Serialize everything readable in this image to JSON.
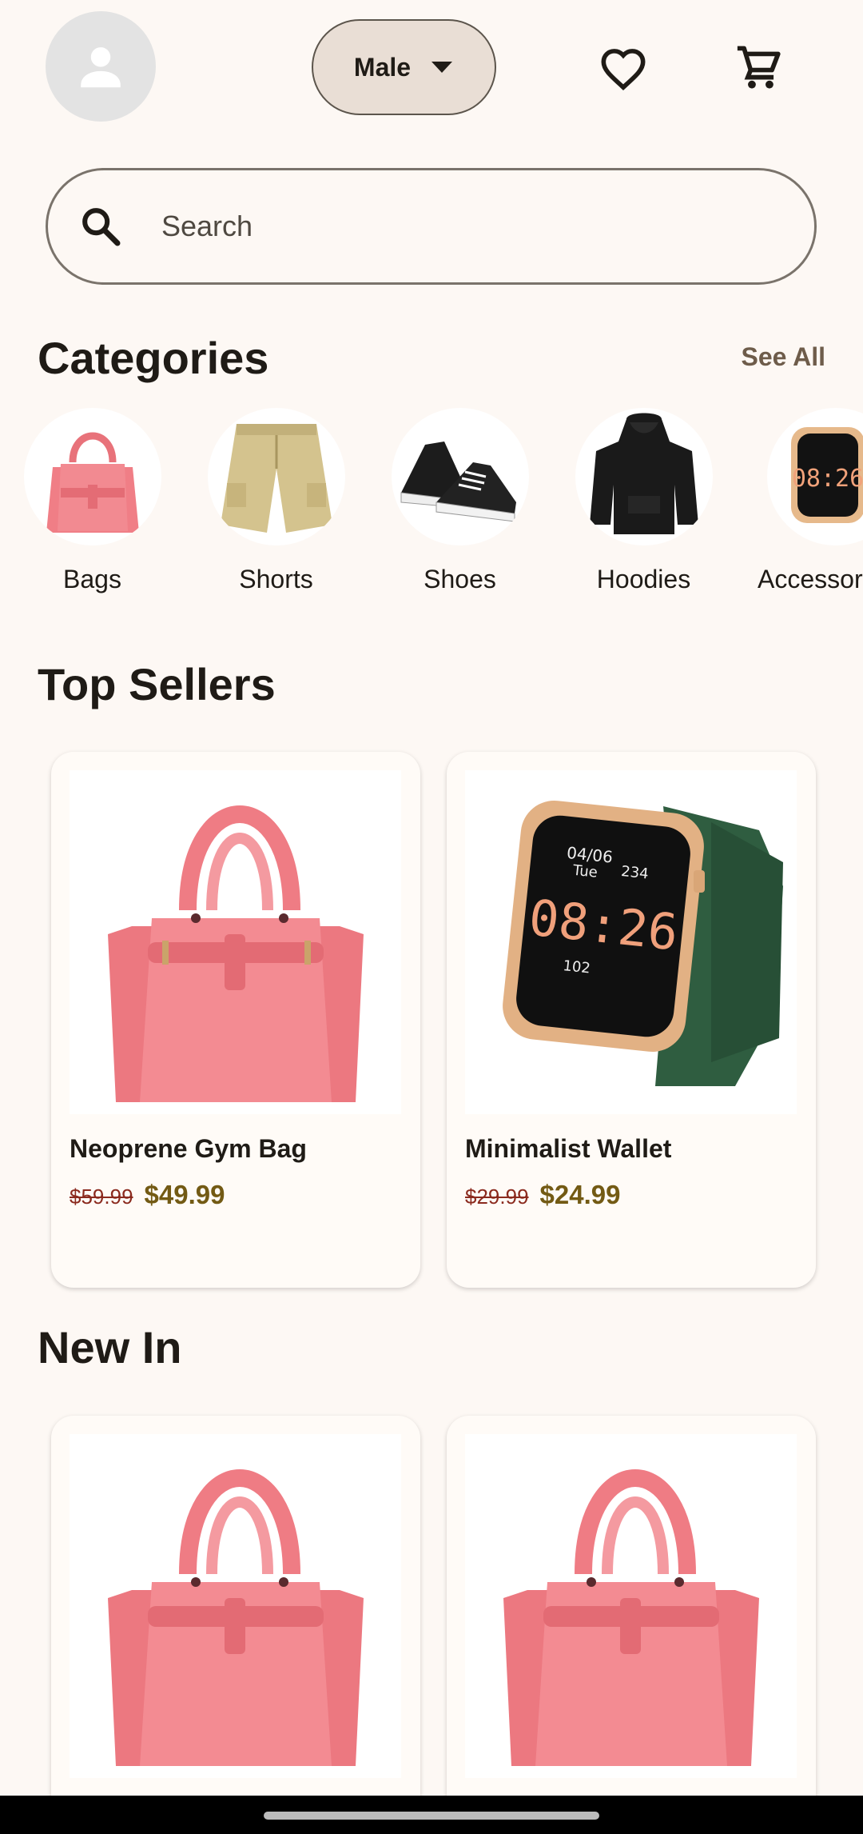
{
  "header": {
    "gender_selected": "Male"
  },
  "search": {
    "placeholder": "Search"
  },
  "categories": {
    "title": "Categories",
    "see_all": "See All",
    "items": [
      {
        "label": "Bags"
      },
      {
        "label": "Shorts"
      },
      {
        "label": "Shoes"
      },
      {
        "label": "Hoodies"
      },
      {
        "label": "Accessories"
      }
    ]
  },
  "top_sellers": {
    "title": "Top Sellers",
    "products": [
      {
        "name": "Neoprene Gym Bag",
        "old_price": "$59.99",
        "price": "$49.99"
      },
      {
        "name": "Minimalist Wallet",
        "old_price": "$29.99",
        "price": "$24.99"
      }
    ]
  },
  "new_in": {
    "title": "New In"
  },
  "colors": {
    "background": "#fdf8f4",
    "accent_price": "#735a14",
    "old_price": "#8b2a1e",
    "dropdown_bg": "#e9ded5"
  }
}
